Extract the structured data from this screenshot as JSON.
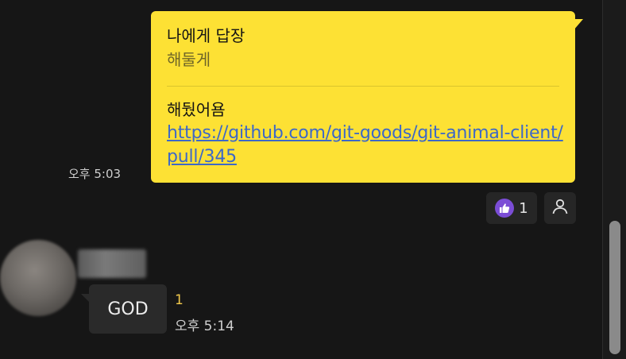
{
  "sent_message": {
    "reply_title": "나에게 답장",
    "reply_quote": "해둘게",
    "text": "해뒀어욤",
    "link": "https://github.com/git-goods/git-animal-client/pull/345",
    "time": "오후 5:03"
  },
  "reactions": {
    "thumb_count": "1",
    "thumb_color": "#7b4dd6"
  },
  "received_message": {
    "text": "GOD",
    "unread_count": "1",
    "time": "오후 5:14"
  },
  "colors": {
    "sent_bubble": "#fde134",
    "link": "#3d68c7",
    "background": "#161616",
    "unread": "#f2c94c"
  },
  "icons": [
    "thumbs-up-icon",
    "person-icon"
  ]
}
